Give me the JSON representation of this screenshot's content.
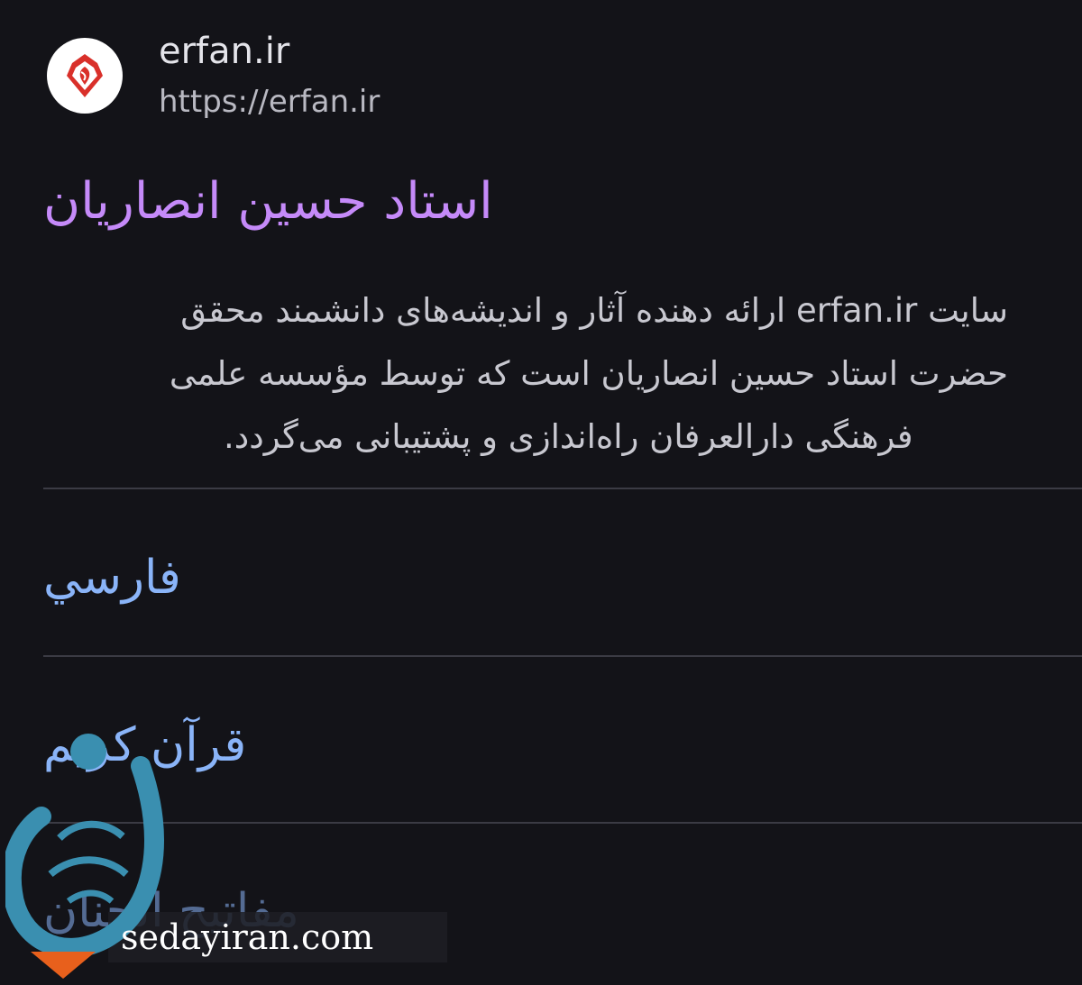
{
  "site": {
    "name": "erfan.ir",
    "url": "https://erfan.ir",
    "favicon_icon": "erfan-logo-icon"
  },
  "result": {
    "title": "استاد حسین انصاریان",
    "snippet_lines": [
      "سایت erfan.ir ارائه دهنده آثار و اندیشه‌های دانشمند محقق",
      "حضرت استاد حسین انصاریان است که توسط مؤسسه علمی",
      "فرهنگی دارالعرفان راه‌اندازی و پشتیبانی می‌گردد."
    ]
  },
  "sitelinks": [
    {
      "label": "فارسي"
    },
    {
      "label": "قرآن کریم"
    },
    {
      "label": "مفاتیح الجنان"
    }
  ],
  "watermark": {
    "text": "sedayiran.com",
    "logo_icon": "sedayiran-logo-icon"
  },
  "colors": {
    "background": "#131318",
    "title": "#c58af9",
    "link": "#8ab4f8",
    "text": "#c8c8d0",
    "divider": "#3b3b44",
    "logo_red": "#d9302a",
    "watermark_teal": "#3a8fb0",
    "watermark_orange": "#e8601c"
  }
}
